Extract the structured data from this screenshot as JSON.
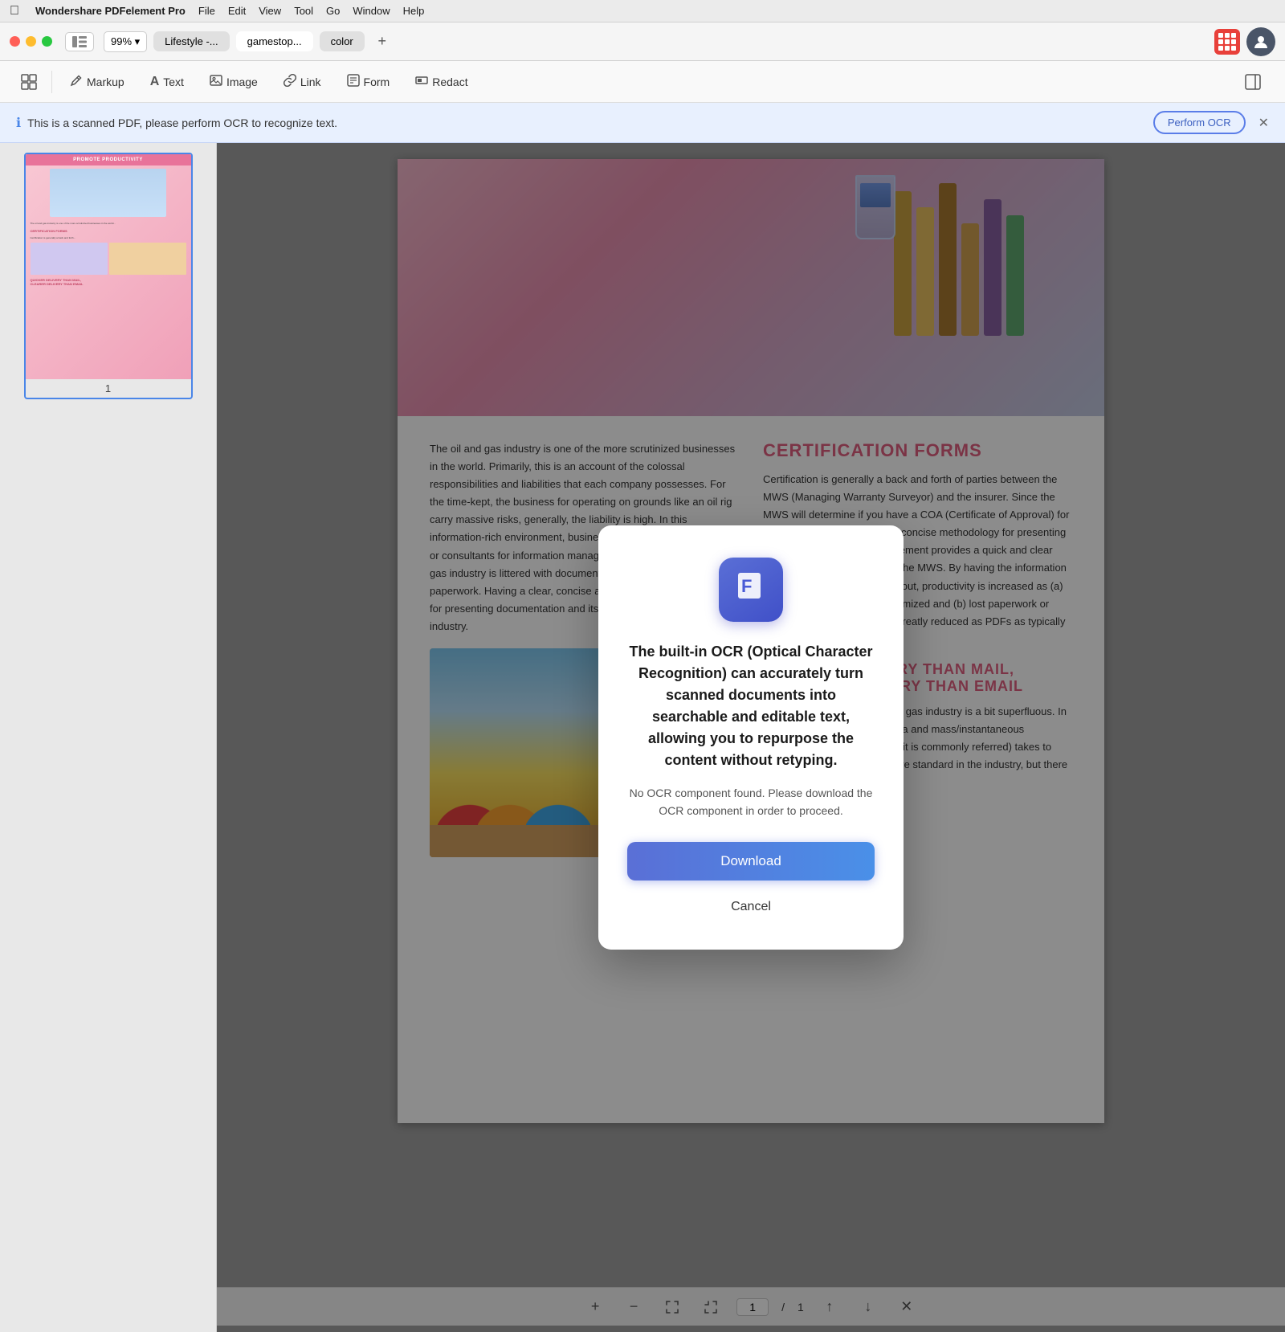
{
  "menubar": {
    "apple": "&#xF8FF;",
    "app_name": "Wondershare PDFelement Pro",
    "items": [
      "File",
      "Edit",
      "View",
      "Tool",
      "Go",
      "Window",
      "Help"
    ]
  },
  "titlebar": {
    "zoom_level": "99%",
    "tabs": [
      {
        "label": "Lifestyle -...",
        "active": false
      },
      {
        "label": "gamestop...",
        "active": true
      },
      {
        "label": "color",
        "active": false
      }
    ],
    "add_tab_label": "+",
    "sidebar_icon": "⊞"
  },
  "toolbar": {
    "items": [
      {
        "id": "layout",
        "icon": "⊞",
        "label": ""
      },
      {
        "id": "markup",
        "icon": "✏️",
        "label": "Markup"
      },
      {
        "id": "text",
        "icon": "A",
        "label": "Text"
      },
      {
        "id": "image",
        "icon": "🖼",
        "label": "Image"
      },
      {
        "id": "link",
        "icon": "🔗",
        "label": "Link"
      },
      {
        "id": "form",
        "icon": "⊞",
        "label": "Form"
      },
      {
        "id": "redact",
        "icon": "▐",
        "label": "Redact"
      },
      {
        "id": "panel",
        "icon": "⊟",
        "label": ""
      }
    ]
  },
  "ocr_banner": {
    "text": "This is a scanned PDF, please perform OCR to recognize text.",
    "button_label": "Perform OCR",
    "icon": "ℹ"
  },
  "sidebar": {
    "page_number": "1"
  },
  "pdf": {
    "promote_title": "PROMOTE PRODUCTIVITY",
    "left_text": "The oil and gas industry is one of the more scrutinized businesses in the world. Primarily, this is an account of the colossal responsibilities and liabilities that each company possesses. For the time-kept, the business for operating on grounds like an oil rig carry massive risks, generally, the liability is high. In this information-rich environment, businesses rely on IT departments or consultants for information management. As such, the oil and gas industry is littered with documents, documentation and paperwork. Having a clear, concise and consistent methodology for presenting documentation and its daily proficiency for the industry.",
    "cert_title": "CERTIFICATION FORMS",
    "cert_text": "Certification is generally a back and forth of parties between the MWS (Managing Warranty Surveyor) and the insurer. Since the MWS will determine if you have a COA (Certificate of Approval) for your oil transport, a clear and concise methodology for presenting documentation is vital. PDFElement provides a quick and clear way to present information to the MWS. By having the information in an easy understandable layout, productivity is increased as (a) the need to re-do tasks is minimized and (b) lost paperwork or misunderstood paperwork is greatly reduced as PDFs as typically delivered digitally.",
    "delivery_title": "QUICKER DELIVERY THAN MAIL, CLEARER DELIVERY THAN EMAIL",
    "delivery_text": "Sending mail in the oil and the gas industry is a bit superfluous. In a modern world of digital media and mass/instantaneous communication, snail mail (as it is commonly referred) takes to long. Emails are generally more standard in the industry, but there are emails without"
  },
  "modal": {
    "icon_letter": "F",
    "title": "The built-in OCR (Optical Character Recognition) can accurately turn scanned documents into searchable and editable text, allowing you to repurpose the content without retyping.",
    "description": "No OCR component found. Please download the OCR component in order to proceed.",
    "download_label": "Download",
    "cancel_label": "Cancel"
  },
  "bottom_bar": {
    "page_current": "1",
    "page_separator": "/",
    "page_total": "1"
  }
}
